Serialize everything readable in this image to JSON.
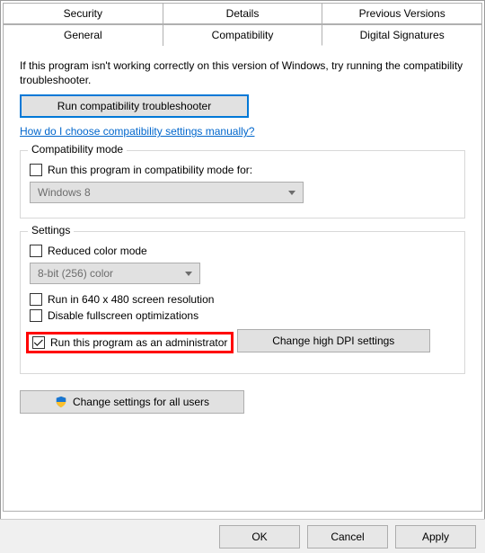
{
  "tabs": {
    "row1": [
      "Security",
      "Details",
      "Previous Versions"
    ],
    "row2": [
      "General",
      "Compatibility",
      "Digital Signatures"
    ],
    "active": "Compatibility"
  },
  "intro": "If this program isn't working correctly on this version of Windows, try running the compatibility troubleshooter.",
  "run_troubleshooter": "Run compatibility troubleshooter",
  "help_link": "How do I choose compatibility settings manually?",
  "compat_group": {
    "title": "Compatibility mode",
    "run_for_label": "Run this program in compatibility mode for:",
    "selected": "Windows 8"
  },
  "settings_group": {
    "title": "Settings",
    "reduced_color": "Reduced color mode",
    "color_selected": "8-bit (256) color",
    "run_640": "Run in 640 x 480 screen resolution",
    "disable_fs": "Disable fullscreen optimizations",
    "run_admin": "Run this program as an administrator",
    "change_dpi": "Change high DPI settings"
  },
  "all_users": "Change settings for all users",
  "buttons": {
    "ok": "OK",
    "cancel": "Cancel",
    "apply": "Apply"
  }
}
